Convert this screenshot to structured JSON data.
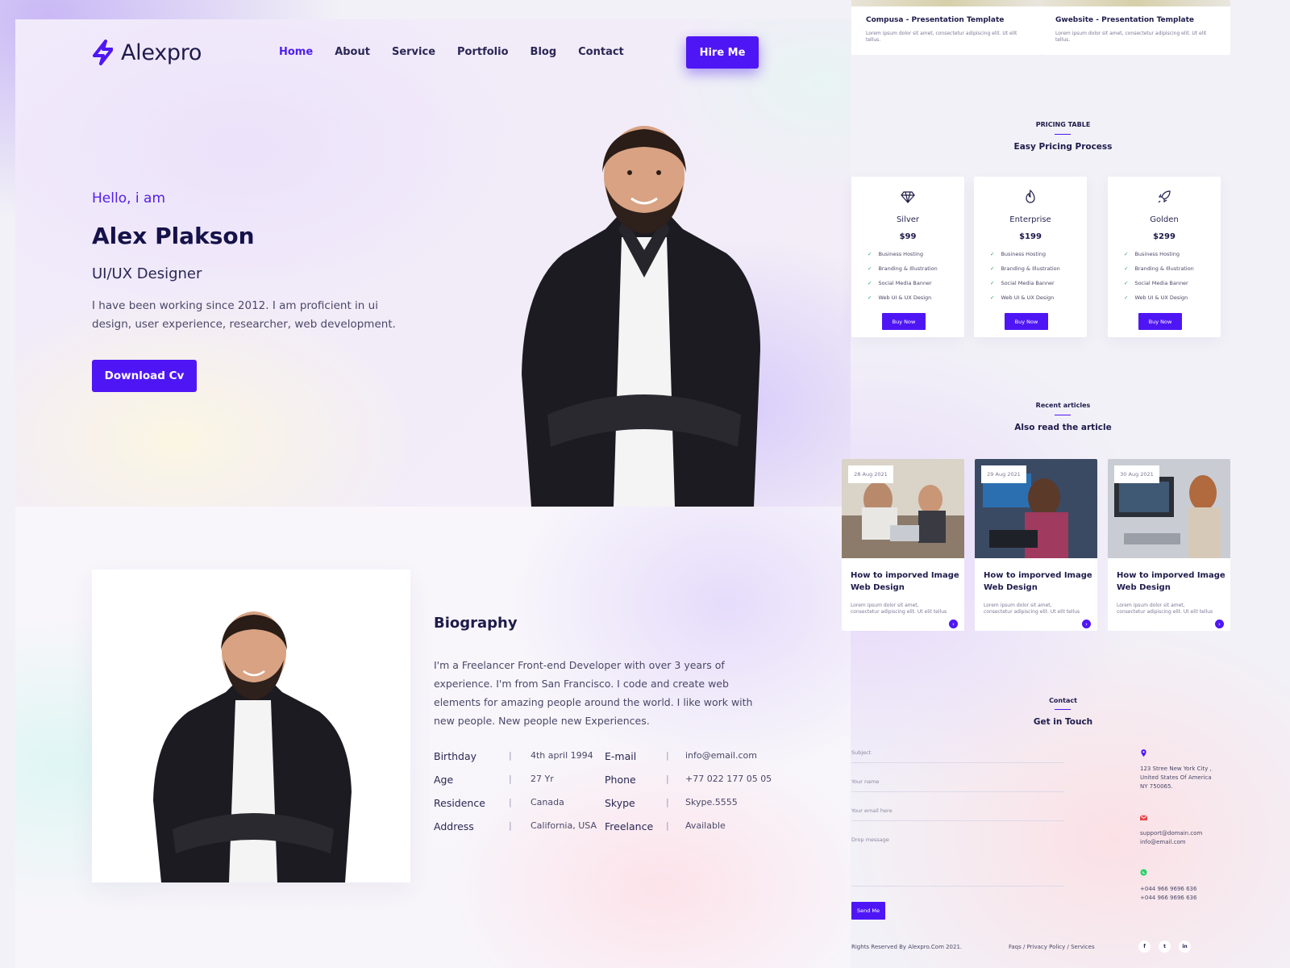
{
  "brand": {
    "name": "Alexpro"
  },
  "nav": {
    "items": [
      "Home",
      "About",
      "Service",
      "Portfolio",
      "Blog",
      "Contact"
    ],
    "active": "Home",
    "hire_label": "Hire Me"
  },
  "hero": {
    "greeting": "Hello, i am",
    "name": "Alex Plakson",
    "role": "UI/UX Designer",
    "intro": "I have been working since 2012. I am proficient in ui design, user experience, researcher, web development.",
    "cta": "Download Cv"
  },
  "bio": {
    "title": "Biography",
    "text": "I'm a Freelancer Front-end Developer with over 3 years of experience. I'm from San Francisco. I code and create web elements for amazing people around the world. I like work with new people. New people new Experiences.",
    "separator": "|",
    "facts": [
      {
        "label": "Birthday",
        "value": "4th april 1994",
        "label2": "E-mail",
        "value2": "info@email.com"
      },
      {
        "label": "Age",
        "value": "27 Yr",
        "label2": "Phone",
        "value2": "+77 022 177 05 05"
      },
      {
        "label": "Residence",
        "value": "Canada",
        "label2": "Skype",
        "value2": "Skype.5555"
      },
      {
        "label": "Address",
        "value": "California, USA",
        "label2": "Freelance",
        "value2": "Available"
      }
    ]
  },
  "portfolio": {
    "cards": [
      {
        "title": "Compusa - Presentation Template",
        "desc": "Lorem ipsum dolor sit amet, consectetur adipiscing elit. Ut elit tellus."
      },
      {
        "title": "Gwebsite - Presentation Template",
        "desc": "Lorem ipsum dolor sit amet, consectetur adipiscing elit. Ut elit tellus."
      }
    ]
  },
  "pricing": {
    "eyebrow": "PRICING TABLE",
    "title": "Easy Pricing Process",
    "features": [
      "Business Hosting",
      "Branding & Illustration",
      "Social Media Banner",
      "Web UI & UX Design"
    ],
    "check": "✓",
    "buy_label": "Buy Now",
    "plans": [
      {
        "name": "Silver",
        "price": "$99",
        "icon": "diamond-icon"
      },
      {
        "name": "Enterprise",
        "price": "$199",
        "icon": "flame-icon"
      },
      {
        "name": "Golden",
        "price": "$299",
        "icon": "rocket-icon"
      }
    ]
  },
  "articles": {
    "eyebrow": "Recent articles",
    "title": "Also read the article",
    "items": [
      {
        "date": "28 Aug 2021",
        "title": "How to imporved Image Web Design",
        "desc": "Lorem ipsum dolor sit amet, consectetur adipiscing elit. Ut elit tellus"
      },
      {
        "date": "29 Aug 2021",
        "title": "How to imporved Image Web Design",
        "desc": "Lorem ipsum dolor sit amet, consectetur adipiscing elit. Ut elit tellus"
      },
      {
        "date": "30 Aug 2021",
        "title": "How to imporved Image Web Design",
        "desc": "Lorem ipsum dolor sit amet, consectetur adipiscing elit. Ut elit tellus"
      }
    ]
  },
  "contact": {
    "eyebrow": "Contact",
    "title": "Get in Touch",
    "fields": {
      "subject": "Subject",
      "name": "Your name",
      "email": "Your email here",
      "message": "Drop message"
    },
    "send_label": "Send Me",
    "address": "123 Stree New York City , United States Of America NY 750065.",
    "emails": "support@domain.com info@email.com",
    "phones": "+044 966 9696 636 +044 966 9696 636"
  },
  "footer": {
    "copyright": "Rights Reserved By Alexpro.Com 2021.",
    "links": "Faqs / Privacy Policy / Services",
    "social": [
      "f",
      "t",
      "in"
    ]
  },
  "colors": {
    "accent": "#4f16f5",
    "heading": "#1e1b4b",
    "body": "#4a4868"
  }
}
